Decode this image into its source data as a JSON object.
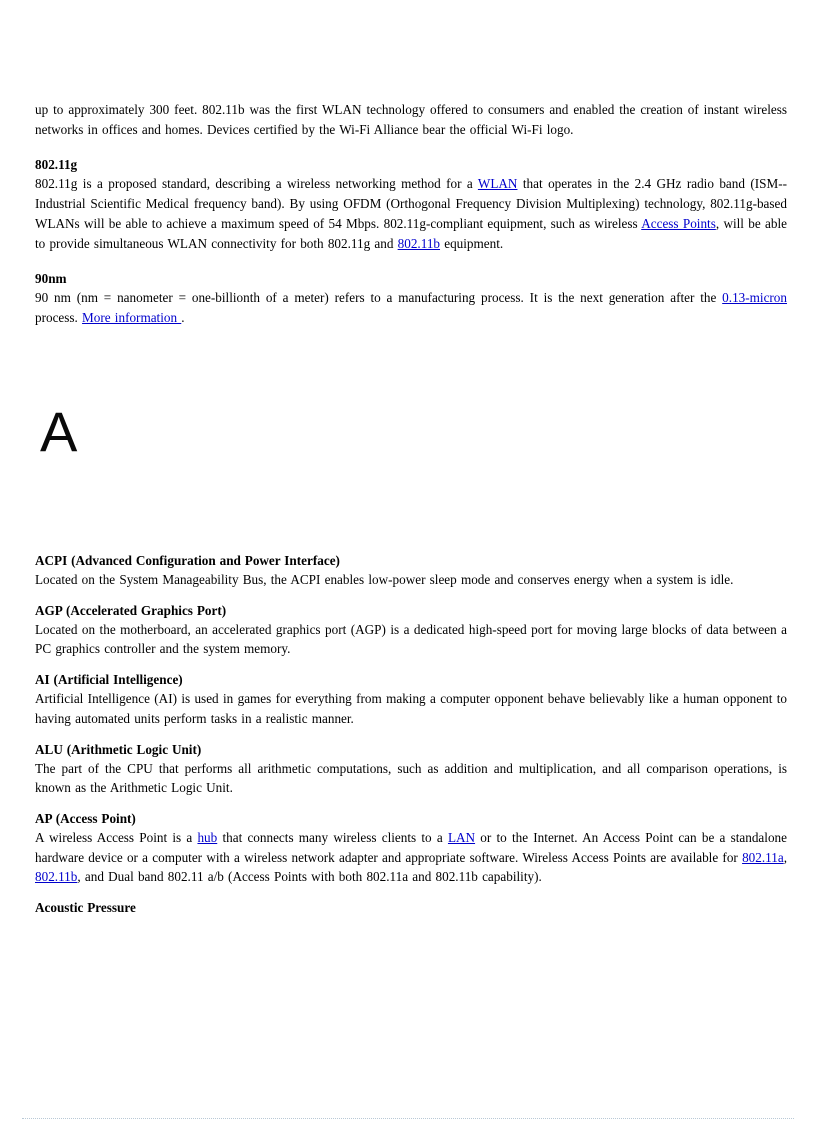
{
  "document": {
    "type": "glossary-page",
    "link_color": "#0000cc",
    "text_color": "#000000",
    "background_color": "#ffffff",
    "section_letter": "A",
    "footer_rule_color": "#b9c9d6"
  },
  "top_paragraph": {
    "part1": "up to approximately  300 feet.  802.11b was the first  WLAN technology  offered  to  consumers  and enabled  the  creation of instant  wireless  networks  in  offices  and homes.  Devices  certified  by the  Wi-Fi  Alliance  bear the  official  Wi-Fi logo."
  },
  "entries": [
    {
      "id": "80211g",
      "heading": "802.11g",
      "segments": [
        {
          "type": "text",
          "value": "802.11g is a proposed standard,  describing  a wireless  networking  method for a "
        },
        {
          "type": "link",
          "value": "WLAN"
        },
        {
          "type": "text",
          "value": " that operates in the  2.4 GHz radio  band (ISM--Industrial  Scientific  Medical frequency  band).  By using  OFDM (Orthogonal  Frequency  Division Multiplexing)   technology,  802.11g-based WLANs will  be able to achieve  a maximum   speed of 54 Mbps. 802.11g-compliant  equipment,  such as wireless  "
        },
        {
          "type": "link",
          "value": "Access Points"
        },
        {
          "type": "text",
          "value": ", will  be able to provide  simultaneous   WLAN connectivity  for both 802.11g and "
        },
        {
          "type": "link",
          "value": "802.11b"
        },
        {
          "type": "text",
          "value": " equipment."
        }
      ]
    },
    {
      "id": "90nm",
      "heading": "90nm",
      "segments": [
        {
          "type": "text",
          "value": "90 nm (nm = nanometer  = one-billionth  of a meter) refers to a manufacturing   process. It is the next generation  after the "
        },
        {
          "type": "link",
          "value": "0.13-micron"
        },
        {
          "type": "text",
          "value": " process. "
        },
        {
          "type": "link",
          "value": "More information "
        },
        {
          "type": "text",
          "value": "."
        }
      ]
    }
  ],
  "a_entries": [
    {
      "id": "acpi",
      "heading": "ACPI (Advanced  Configuration  and Power Interface)",
      "segments": [
        {
          "type": "text",
          "value": "Located on the System  Manageability   Bus,  the  ACPI enables low-power  sleep  mode and conserves  energy  when a system  is idle."
        }
      ]
    },
    {
      "id": "agp",
      "heading": "AGP (Accelerated Graphics  Port)",
      "segments": [
        {
          "type": "text",
          "value": "Located on the motherboard,  an accelerated  graphics  port (AGP) is a dedicated  high-speed  port for moving  large blocks  of data between a PC graphics  controller  and the  system  memory."
        }
      ]
    },
    {
      "id": "ai",
      "heading": "AI (Artificial  Intelligence)",
      "segments": [
        {
          "type": "text",
          "value": "Artificial   Intelligence   (AI) is used in games  for everything  from making  a computer  opponent  behave  believably  like a human  opponent to having  automated  units  perform tasks in  a realistic  manner."
        }
      ]
    },
    {
      "id": "alu",
      "heading": "ALU (Arithmetic  Logic Unit)",
      "segments": [
        {
          "type": "text",
          "value": "The part of the  CPU that performs  all arithmetic   computations,  such  as addition  and multiplication,   and all comparison  operations,  is known  as the Arithmetic   Logic  Unit."
        }
      ]
    },
    {
      "id": "ap",
      "heading": "AP (Access Point)",
      "segments": [
        {
          "type": "text",
          "value": "A wireless  Access Point is a "
        },
        {
          "type": "link",
          "value": "hub"
        },
        {
          "type": "text",
          "value": " that connects  many  wireless  clients  to a "
        },
        {
          "type": "link",
          "value": "LAN"
        },
        {
          "type": "text",
          "value": " or to the Internet.  An Access Point can be a standalone  hardware  device  or a computer  with  a wireless  network adapter and appropriate  software.  Wireless Access Points  are available  for "
        },
        {
          "type": "link",
          "value": "802.11a"
        },
        {
          "type": "text",
          "value": ", "
        },
        {
          "type": "link",
          "value": "802.11b"
        },
        {
          "type": "text",
          "value": ", and Dual  band 802.11 a/b (Access  Points  with  both 802.11a and 802.11b capability)."
        }
      ]
    },
    {
      "id": "acoustic-pressure",
      "heading": "Acoustic Pressure",
      "segments": []
    }
  ]
}
